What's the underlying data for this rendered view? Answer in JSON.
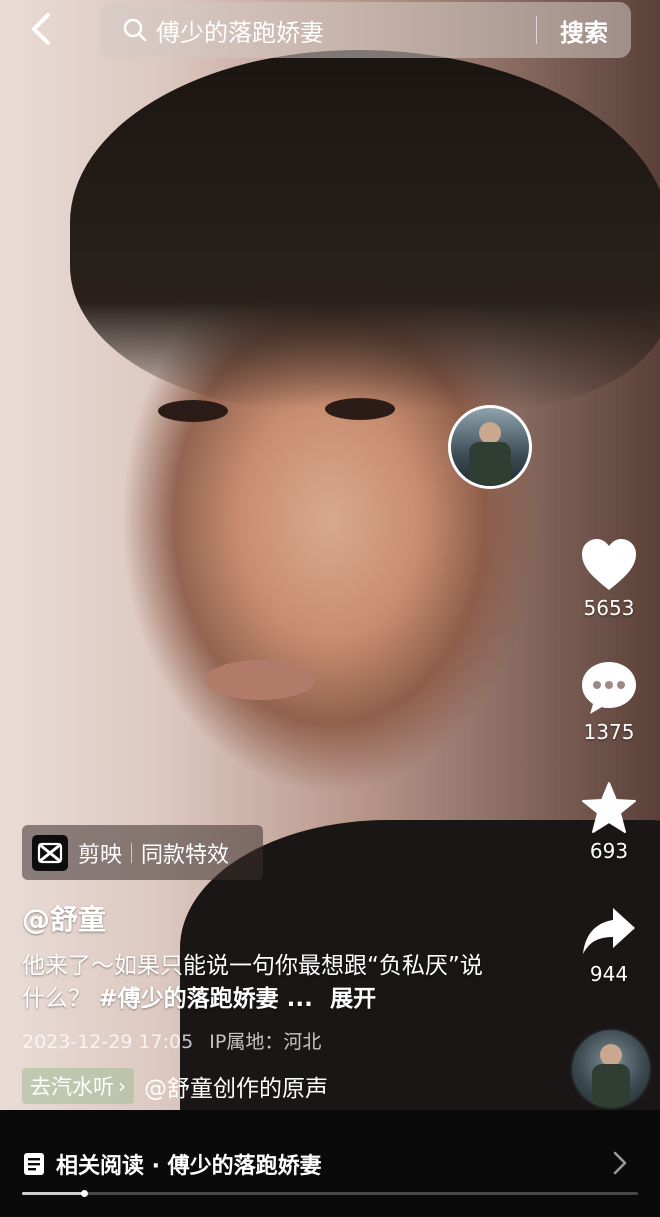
{
  "search": {
    "query": "傅少的落跑娇妻",
    "button_label": "搜索"
  },
  "actions": {
    "likes": "5653",
    "comments": "1375",
    "favorites": "693",
    "shares": "944"
  },
  "capcut": {
    "app_label": "剪映",
    "effect_label": "同款特效"
  },
  "post": {
    "author": "@舒童",
    "caption_text": "他来了～如果只能说一句你最想跟“负私厌”说什么？",
    "caption_tag": "#傅少的落跑娇妻 ...",
    "expand_label": "展开",
    "date": "2023-12-29 17:05",
    "ip_location": "IP属地：河北"
  },
  "sound": {
    "chip_label": "去汽水听",
    "title": "@舒童创作的原声"
  },
  "related": {
    "label": "相关阅读 · 傅少的落跑娇妻"
  },
  "progress": {
    "fraction": 0.1
  },
  "icons": [
    "back-icon",
    "search-icon",
    "heart-icon",
    "comment-icon",
    "star-icon",
    "share-icon",
    "capcut-logo-icon",
    "document-icon",
    "chevron-right-icon"
  ]
}
